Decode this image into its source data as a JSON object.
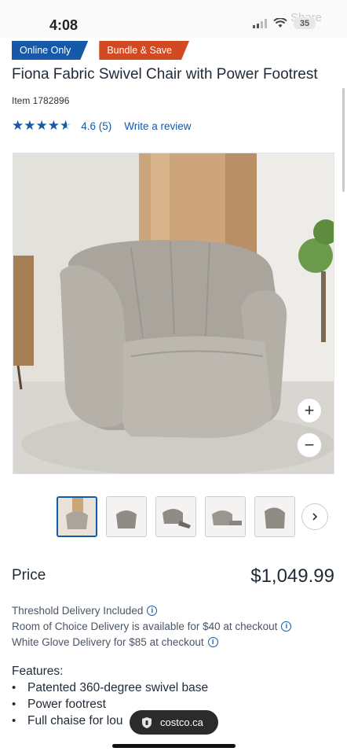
{
  "status_bar": {
    "time": "4:08",
    "battery": "35",
    "share_label": "Share"
  },
  "badges": {
    "online": "Online Only",
    "bundle": "Bundle & Save"
  },
  "product": {
    "title": "Fiona Fabric Swivel Chair with Power Footrest",
    "item_number": "Item  1782896",
    "rating_value": 4.6,
    "rating_text": "4.6 (5)",
    "write_review": "Write a review"
  },
  "gallery": {
    "zoom_in_icon": "plus-icon",
    "zoom_out_icon": "minus-icon",
    "thumbnail_count": 5,
    "active_thumbnail": 1,
    "next_icon": "chevron-right-icon"
  },
  "pricing": {
    "label": "Price",
    "value": "$1,049.99"
  },
  "delivery": [
    "Threshold Delivery Included",
    "Room of Choice Delivery is available for $40 at checkout",
    "White Glove Delivery for $85 at checkout"
  ],
  "features": {
    "title": "Features:",
    "items": [
      "Patented 360-degree swivel base",
      "Power footrest",
      "Full chaise for lou"
    ]
  },
  "browser": {
    "url": "costco.ca",
    "url_icon": "shield-icon"
  },
  "colors": {
    "brand_blue": "#1559a8",
    "bundle_orange": "#d24a22",
    "text": "#1f2a37"
  }
}
